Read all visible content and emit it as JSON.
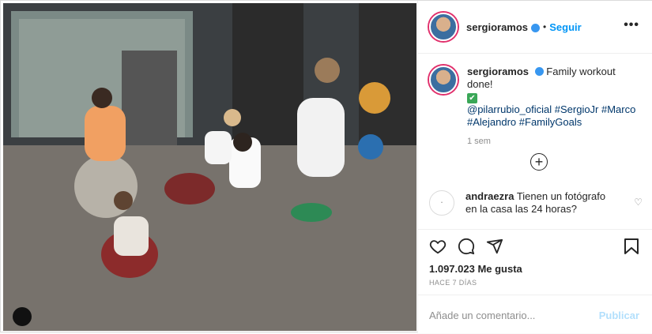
{
  "post": {
    "username": "sergioramos",
    "dot": "•",
    "follow_label": "Seguir",
    "more_label": "•••",
    "caption_username": "sergioramos",
    "caption_text": "Family workout done!",
    "emoji": "✔",
    "caption_tags": "@pilarrubio_oficial #SergioJr #Marco #Alejandro #FamilyGoals",
    "caption_time": "1 sem",
    "comment_username": "andraezra",
    "comment_text": "Tienen un fotógrafo en la casa las 24 horas?",
    "likes": "1.097.023 Me gusta",
    "time_ago": "HACE 7 DÍAS",
    "comment_placeholder": "Añade un comentario...",
    "post_label": "Publicar",
    "icons": [
      "heart-icon",
      "comment-icon",
      "share-icon",
      "bookmark-icon",
      "verified-icon",
      "plus-circle-icon"
    ],
    "colors": {
      "accent": "#0095f6",
      "verified": "#3897f0",
      "muted": "#8e8e8e"
    }
  }
}
